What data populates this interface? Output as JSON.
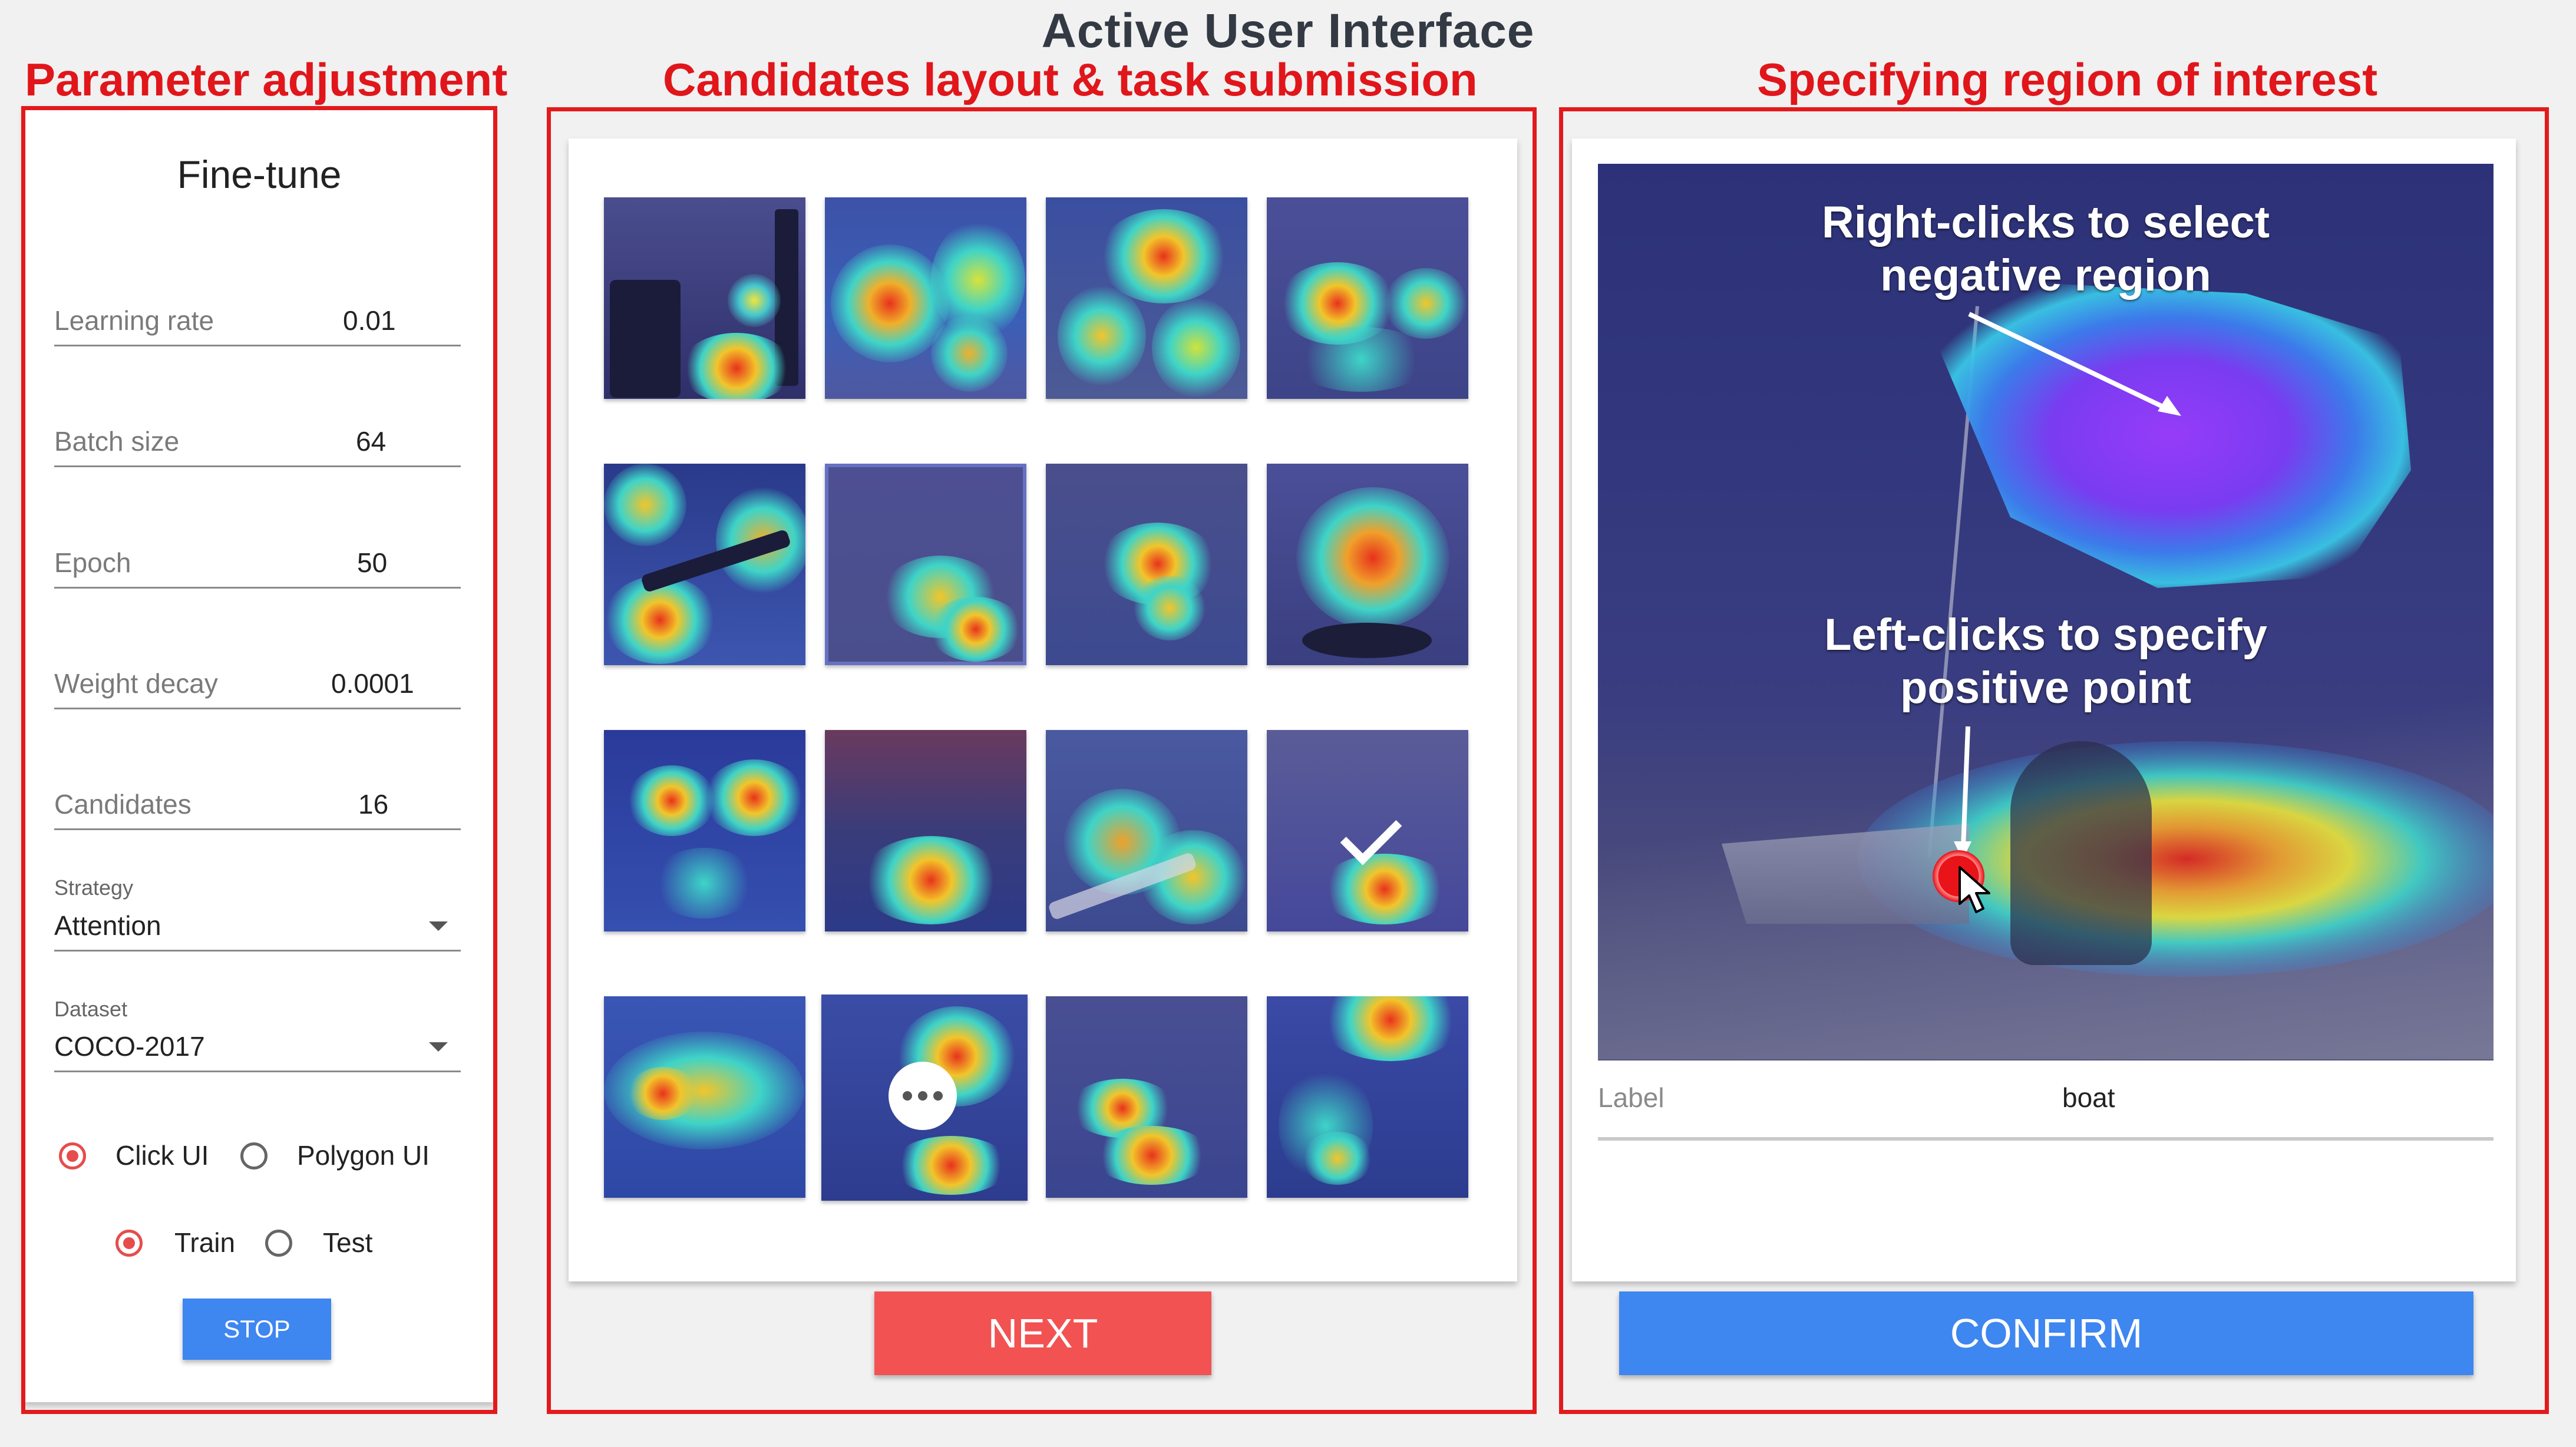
{
  "page_title": "Active User Interface",
  "sections": {
    "parameter": "Parameter adjustment",
    "candidates": "Candidates layout & task submission",
    "roi": "Specifying region of interest"
  },
  "finetune": {
    "title": "Fine-tune",
    "params": [
      {
        "label": "Learning rate",
        "value": "0.01"
      },
      {
        "label": "Batch size",
        "value": "64"
      },
      {
        "label": "Epoch",
        "value": "50"
      },
      {
        "label": "Weight decay",
        "value": "0.0001"
      },
      {
        "label": "Candidates",
        "value": "16"
      }
    ],
    "strategy": {
      "label": "Strategy",
      "value": "Attention"
    },
    "dataset": {
      "label": "Dataset",
      "value": "COCO-2017"
    },
    "ui_mode": {
      "options": [
        "Click UI",
        "Polygon UI"
      ],
      "selected": "Click UI"
    },
    "phase": {
      "options": [
        "Train",
        "Test"
      ],
      "selected": "Train"
    },
    "stop_label": "STOP"
  },
  "candidates": {
    "count": 16,
    "selected_index": 11,
    "menu_index": 13,
    "next_label": "NEXT"
  },
  "roi": {
    "negative_hint_line1": "Right-clicks to select",
    "negative_hint_line2": "negative region",
    "positive_hint_line1": "Left-clicks to specify",
    "positive_hint_line2": "positive point",
    "label_caption": "Label",
    "label_value": "boat",
    "confirm_label": "CONFIRM"
  },
  "colors": {
    "annotation_red": "#e31a1c",
    "next_button": "#f25252",
    "confirm_button": "#3e86f0",
    "stop_button": "#3e86f0",
    "radio_selected": "#e74c4c"
  },
  "icons": [
    "check-icon",
    "more-horiz-icon",
    "cursor-icon",
    "dropdown-caret-icon"
  ]
}
